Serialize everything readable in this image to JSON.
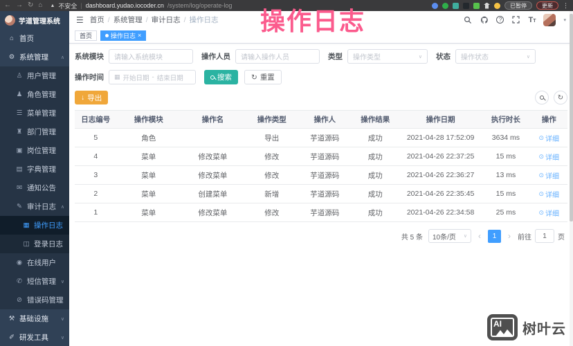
{
  "browser": {
    "security_label": "不安全",
    "divider": "|",
    "url_host": "dashboard.yudao.iocoder.cn",
    "url_path": "/system/log/operate-log",
    "paused_label": "已暂停",
    "update_label": "更新",
    "nav_glyphs": {
      "back": "←",
      "forward": "→",
      "reload": "↻",
      "home": "⌂",
      "warning": "▲",
      "kebab": "⋮"
    },
    "extensions": [
      {
        "name": "extension-blue-icon",
        "color": "#5b8def",
        "shape": "circle"
      },
      {
        "name": "extension-green-shield-icon",
        "color": "#2fae4a",
        "shape": "circle"
      },
      {
        "name": "extension-teal-icon",
        "color": "#3fae9e",
        "shape": "square"
      },
      {
        "name": "extension-dark-icon",
        "color": "#23282d",
        "shape": "square"
      },
      {
        "name": "extension-sprout-icon",
        "color": "#57c24c",
        "shape": "square"
      },
      {
        "name": "extension-pin-icon",
        "color": "#d8d8d8",
        "shape": "pin"
      },
      {
        "name": "smiley-icon",
        "color": "#f6c244",
        "shape": "circle"
      }
    ]
  },
  "overlay": {
    "title": "操作日志",
    "color": "#fb5b8d"
  },
  "watermark": {
    "logo_text": "AI",
    "brand": "树叶云"
  },
  "sidebar": {
    "logo_title": "芋道管理系统",
    "arrow_up": "∧",
    "arrow_down": "∨",
    "items": [
      {
        "label": "首页",
        "icon": "home-icon",
        "glyph": "⌂",
        "level": 1
      },
      {
        "label": "系统管理",
        "icon": "gear-icon",
        "glyph": "⚙",
        "level": 1,
        "arrow": "up"
      },
      {
        "label": "用户管理",
        "icon": "user-icon",
        "glyph": "♙",
        "level": 2
      },
      {
        "label": "角色管理",
        "icon": "role-icon",
        "glyph": "♟",
        "level": 2
      },
      {
        "label": "菜单管理",
        "icon": "menu-tree-icon",
        "glyph": "☰",
        "level": 2
      },
      {
        "label": "部门管理",
        "icon": "dept-tree-icon",
        "glyph": "♜",
        "level": 2
      },
      {
        "label": "岗位管理",
        "icon": "post-icon",
        "glyph": "▣",
        "level": 2
      },
      {
        "label": "字典管理",
        "icon": "dict-icon",
        "glyph": "▤",
        "level": 2
      },
      {
        "label": "通知公告",
        "icon": "notice-icon",
        "glyph": "✉",
        "level": 2
      },
      {
        "label": "审计日志",
        "icon": "audit-log-icon",
        "glyph": "✎",
        "level": 2,
        "arrow": "up"
      },
      {
        "label": "操作日志",
        "icon": "operate-log-icon",
        "glyph": "▦",
        "level": 3,
        "active": true
      },
      {
        "label": "登录日志",
        "icon": "login-log-icon",
        "glyph": "◫",
        "level": 3
      },
      {
        "label": "在线用户",
        "icon": "online-user-icon",
        "glyph": "◉",
        "level": 2
      },
      {
        "label": "短信管理",
        "icon": "sms-icon",
        "glyph": "✆",
        "level": 2,
        "arrow": "down"
      },
      {
        "label": "错误码管理",
        "icon": "error-code-icon",
        "glyph": "⊘",
        "level": 2
      },
      {
        "label": "基础设施",
        "icon": "infra-icon",
        "glyph": "⚒",
        "level": 1,
        "arrow": "down"
      },
      {
        "label": "研发工具",
        "icon": "devtools-icon",
        "glyph": "✐",
        "level": 1,
        "arrow": "down"
      }
    ]
  },
  "navbar": {
    "hamburger": "☰",
    "breadcrumb": [
      "首页",
      "系统管理",
      "审计日志",
      "操作日志"
    ],
    "separator": "/",
    "help_glyph": "?",
    "font_icon_big": "T",
    "font_icon_small": "T",
    "caret": "▾"
  },
  "tabs": {
    "home_label": "首页",
    "active_label": "操作日志",
    "close_glyph": "×"
  },
  "filters": {
    "module_label": "系统模块",
    "module_placeholder": "请输入系统模块",
    "operator_label": "操作人员",
    "operator_placeholder": "请输入操作人员",
    "type_label": "类型",
    "type_placeholder": "操作类型",
    "status_label": "状态",
    "status_placeholder": "操作状态",
    "time_label": "操作时间",
    "start_placeholder": "开始日期",
    "range_separator": "-",
    "end_placeholder": "结束日期",
    "calendar_glyph": "▦",
    "chevron": "∨",
    "search_label": "搜索",
    "reset_label": "重置",
    "reset_glyph": "↻"
  },
  "toolbar": {
    "export_label": "导出",
    "export_glyph": "↓",
    "refresh_glyph": "↻"
  },
  "table": {
    "columns": [
      "日志编号",
      "操作模块",
      "操作名",
      "操作类型",
      "操作人",
      "操作结果",
      "操作日期",
      "执行时长",
      "操作"
    ],
    "detail_glyph": "⊙",
    "rows": [
      {
        "id": "5",
        "module": "角色",
        "name": "",
        "type": "导出",
        "operator": "芋道源码",
        "result": "成功",
        "date": "2021-04-28 17:52:09",
        "duration": "3634 ms",
        "action": "详细"
      },
      {
        "id": "4",
        "module": "菜单",
        "name": "修改菜单",
        "type": "修改",
        "operator": "芋道源码",
        "result": "成功",
        "date": "2021-04-26 22:37:25",
        "duration": "15 ms",
        "action": "详细"
      },
      {
        "id": "3",
        "module": "菜单",
        "name": "修改菜单",
        "type": "修改",
        "operator": "芋道源码",
        "result": "成功",
        "date": "2021-04-26 22:36:27",
        "duration": "13 ms",
        "action": "详细"
      },
      {
        "id": "2",
        "module": "菜单",
        "name": "创建菜单",
        "type": "新增",
        "operator": "芋道源码",
        "result": "成功",
        "date": "2021-04-26 22:35:45",
        "duration": "15 ms",
        "action": "详细"
      },
      {
        "id": "1",
        "module": "菜单",
        "name": "修改菜单",
        "type": "修改",
        "operator": "芋道源码",
        "result": "成功",
        "date": "2021-04-26 22:34:58",
        "duration": "25 ms",
        "action": "详细"
      }
    ]
  },
  "pagination": {
    "total": "共 5 条",
    "page_size": "10条/页",
    "chevron": "∨",
    "prev": "‹",
    "page": "1",
    "next": "›",
    "goto_label": "前往",
    "goto_value": "1",
    "unit": "页"
  },
  "colors": {
    "accent": "#409EFF",
    "sidebar_bg": "#304156",
    "export_button": "#F0A73A",
    "search_button": "#2BB3A2",
    "overlay_pink": "#FB5B8D",
    "success_text": "#606266"
  }
}
